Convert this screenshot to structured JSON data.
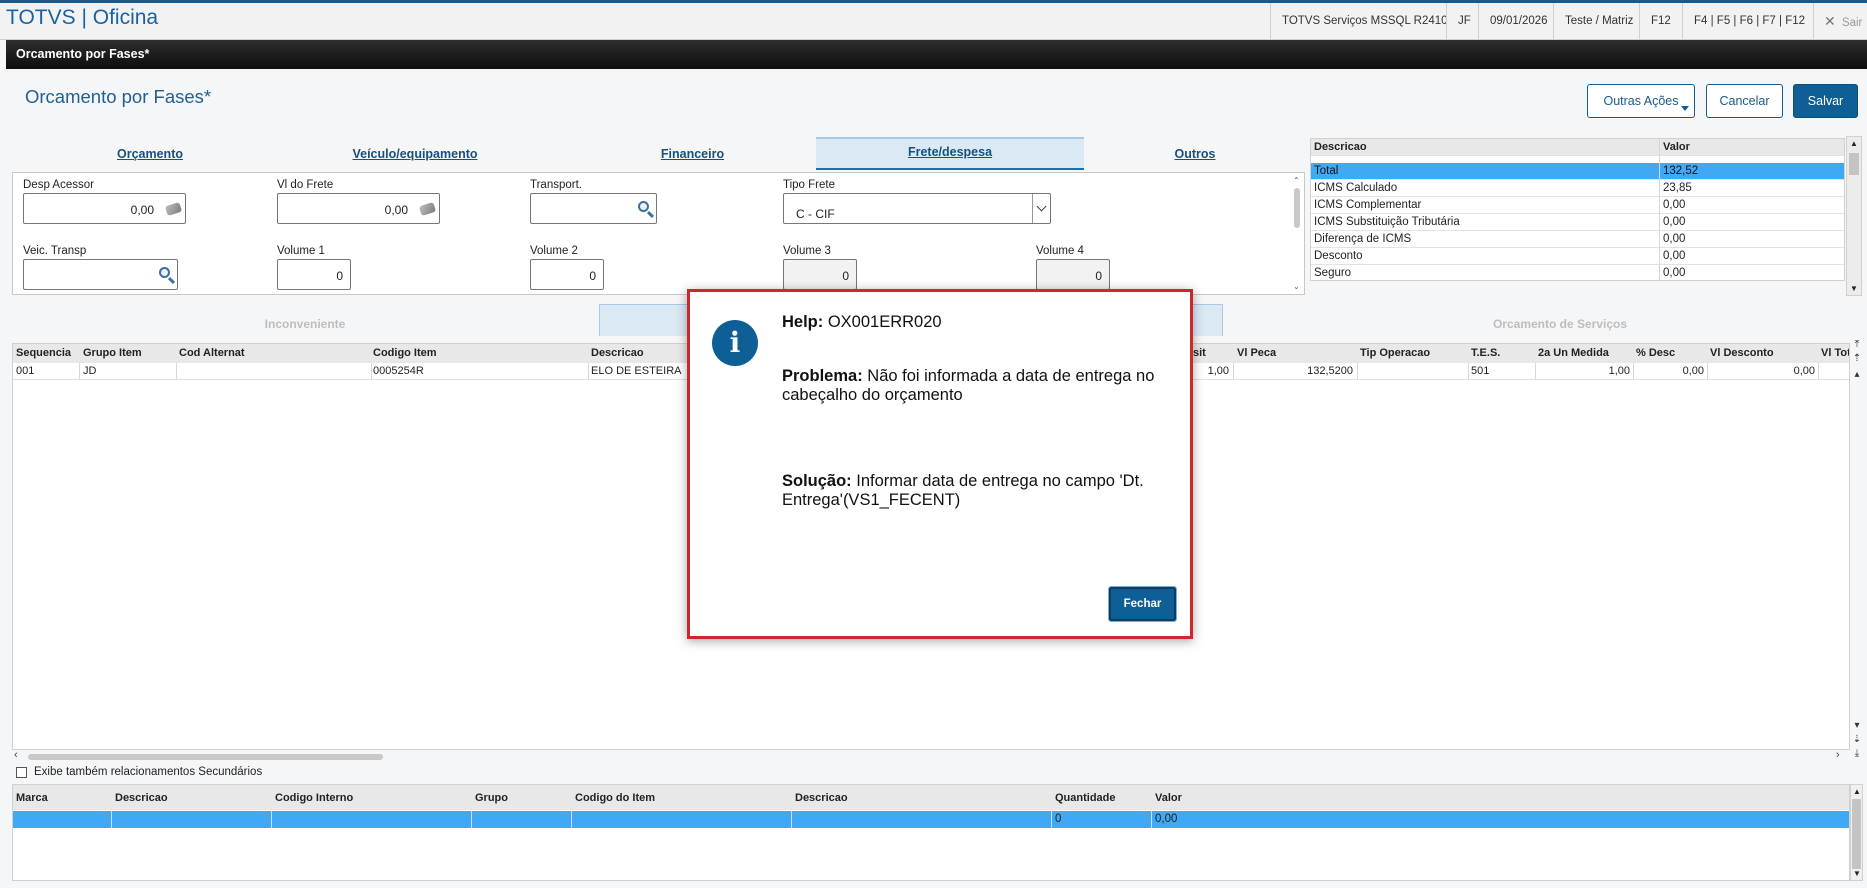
{
  "app": {
    "title": "TOTVS | Oficina",
    "env": "TOTVS Serviços MSSQL R2410",
    "user": "JF",
    "date": "09/01/2026",
    "company": "Teste / Matriz",
    "help_key": "F12",
    "shortcuts": "F4 | F5 | F6 | F7 | F12",
    "exit_label": "Sair"
  },
  "window": {
    "title": "Orcamento por Fases*"
  },
  "page": {
    "title": "Orcamento por Fases*",
    "buttons": {
      "outras": "Outras Ações",
      "cancelar": "Cancelar",
      "salvar": "Salvar"
    }
  },
  "tabs": [
    {
      "label": "Orçamento"
    },
    {
      "label": "Veículo/equipamento"
    },
    {
      "label": "Financeiro"
    },
    {
      "label": "Frete/despesa",
      "active": true
    },
    {
      "label": "Outros"
    }
  ],
  "form": {
    "desp_acessor": {
      "label": "Desp Acessor",
      "value": "0,00"
    },
    "vl_frete": {
      "label": "Vl do Frete",
      "value": "0,00"
    },
    "transport": {
      "label": "Transport.",
      "value": ""
    },
    "tipo_frete": {
      "label": "Tipo Frete",
      "value": "C - CIF"
    },
    "veic_transp": {
      "label": "Veic. Transp",
      "value": ""
    },
    "volume1": {
      "label": "Volume 1",
      "value": "0"
    },
    "volume2": {
      "label": "Volume 2",
      "value": "0"
    },
    "volume3": {
      "label": "Volume 3",
      "value": "0"
    },
    "volume4": {
      "label": "Volume 4",
      "value": "0"
    }
  },
  "summary": {
    "headers": {
      "desc": "Descricao",
      "valor": "Valor"
    },
    "rows": [
      {
        "desc": "Total",
        "valor": "132,52"
      },
      {
        "desc": "ICMS Calculado",
        "valor": "23,85"
      },
      {
        "desc": "ICMS Complementar",
        "valor": "0,00"
      },
      {
        "desc": "ICMS Substituição Tributária",
        "valor": "0,00"
      },
      {
        "desc": "Diferença de ICMS",
        "valor": "0,00"
      },
      {
        "desc": "Desconto",
        "valor": "0,00"
      },
      {
        "desc": "Seguro",
        "valor": "0,00"
      }
    ]
  },
  "subtabs": {
    "inconveniente": "Inconveniente",
    "servicos": "Orcamento de Serviços"
  },
  "grid": {
    "headers": {
      "sequencia": "Sequencia",
      "grupo": "Grupo Item",
      "cod_alt": "Cod Alternat",
      "codigo": "Codigo Item",
      "descricao": "Descricao",
      "sit": "sit",
      "vl_peca": "Vl Peca",
      "tip_op": "Tip Operacao",
      "tes": "T.E.S.",
      "un2": "2a Un Medida",
      "desc_pct": "% Desc",
      "vl_desc": "Vl Desconto",
      "vl_total": "Vl Tot"
    },
    "row": {
      "sequencia": "001",
      "grupo": "JD",
      "cod_alt": "",
      "codigo": "0005254R",
      "descricao": "ELO DE ESTEIRA",
      "sit": "1,00",
      "vl_peca": "132,5200",
      "tip_op": "",
      "tes": "501",
      "un2": "1,00",
      "desc_pct": "0,00",
      "vl_desc": "0,00"
    }
  },
  "checkbox_label": "Exibe também relacionamentos Secundários",
  "bottom_grid": {
    "headers": {
      "marca": "Marca",
      "descricao": "Descricao",
      "cod_interno": "Codigo Interno",
      "grupo": "Grupo",
      "cod_item": "Codigo do Item",
      "descricao2": "Descricao",
      "quantidade": "Quantidade",
      "valor": "Valor"
    },
    "row": {
      "quantidade": "0",
      "valor": "0,00"
    }
  },
  "modal": {
    "help_label": "Help:",
    "help_code": "OX001ERR020",
    "problem_label": "Problema:",
    "problem_line1": "Não foi informada a data de entrega no",
    "problem_line2": "cabeçalho do orçamento",
    "solution_label": "Solução:",
    "solution_line1": "Informar data de entrega no campo 'Dt.",
    "solution_line2": "Entrega'(VS1_FECENT)",
    "close_label": "Fechar"
  },
  "colors": {
    "accent": "#0e5f95",
    "selection": "#3fa9f5",
    "modal_border": "#cc2a2a"
  }
}
